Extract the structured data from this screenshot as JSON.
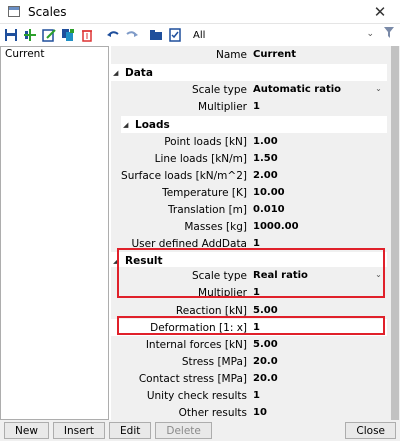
{
  "window": {
    "title": "Scales",
    "close_glyph": "✕"
  },
  "toolbar": {
    "icons": [
      "save-icon",
      "add-icon",
      "edit-icon",
      "copy-icon",
      "delete-icon",
      "undo-icon",
      "redo-icon",
      "open-folder-icon",
      "checklist-icon"
    ],
    "filter_label": "All"
  },
  "list": {
    "items": [
      "Current"
    ]
  },
  "props": {
    "name": {
      "label": "Name",
      "value": "Current"
    },
    "data_section": "Data",
    "scale_type_1": {
      "label": "Scale type",
      "value": "Automatic ratio"
    },
    "multiplier_1": {
      "label": "Multiplier",
      "value": "1"
    },
    "loads_section": "Loads",
    "loads": [
      {
        "label": "Point loads [kN]",
        "value": "1.00"
      },
      {
        "label": "Line loads [kN/m]",
        "value": "1.50"
      },
      {
        "label": "Surface loads [kN/m^2]",
        "value": "2.00"
      },
      {
        "label": "Temperature [K]",
        "value": "10.00"
      },
      {
        "label": "Translation [m]",
        "value": "0.010"
      },
      {
        "label": "Masses [kg]",
        "value": "1000.00"
      },
      {
        "label": "User defined AddData",
        "value": "1"
      }
    ],
    "result_section": "Result",
    "scale_type_2": {
      "label": "Scale type",
      "value": "Real ratio"
    },
    "multiplier_2": {
      "label": "Multiplier",
      "value": "1"
    },
    "results": [
      {
        "label": "Reaction [kN]",
        "value": "5.00"
      },
      {
        "label": "Deformation [1: x]",
        "value": "1"
      },
      {
        "label": "Internal forces [kN]",
        "value": "5.00"
      },
      {
        "label": "Stress [MPa]",
        "value": "20.0"
      },
      {
        "label": "Contact stress [MPa]",
        "value": "20.0"
      },
      {
        "label": "Unity check results",
        "value": "1"
      },
      {
        "label": "Other results",
        "value": "10"
      }
    ]
  },
  "buttons": {
    "new": "New",
    "insert": "Insert",
    "edit": "Edit",
    "delete": "Delete",
    "close": "Close"
  },
  "colors": {
    "highlight": "#e0202a"
  }
}
